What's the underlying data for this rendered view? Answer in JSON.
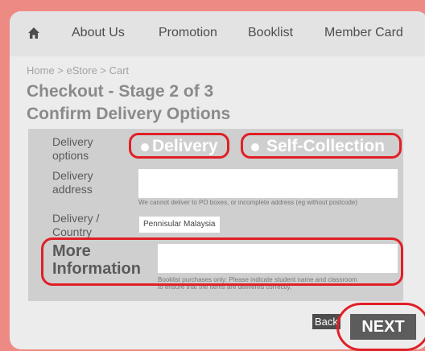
{
  "nav": {
    "home_icon": "home-icon",
    "items": [
      "About Us",
      "Promotion",
      "Booklist",
      "Member Card"
    ]
  },
  "breadcrumb": "Home > eStore > Cart",
  "title": {
    "line1": "Checkout - Stage 2 of 3",
    "line2": "Confirm Delivery Options"
  },
  "form": {
    "delivery_options_label_1": "Delivery",
    "delivery_options_label_2": "options",
    "option_delivery": "Delivery",
    "option_self_collection": "Self-Collection",
    "address_label_1": "Delivery",
    "address_label_2": "address",
    "address_value": "",
    "address_hint": "We cannot deliver to PO boxes, or incomplete address (eg without postcode)",
    "country_label_1": "Delivery /",
    "country_label_2": "Country",
    "country_value": "Pennisular Malaysia",
    "more_info_label_1": "More",
    "more_info_label_2": "Information",
    "more_info_value": "",
    "more_info_hint_1": "Booklist purchases only: Please indicate student name and classroom",
    "more_info_hint_2": "to ensure that the items are delivered correctly."
  },
  "buttons": {
    "back": "Back",
    "next": "NEXT"
  },
  "colors": {
    "background": "#ee8a84",
    "highlight": "#e01f26",
    "panel": "#cfcfcf"
  }
}
